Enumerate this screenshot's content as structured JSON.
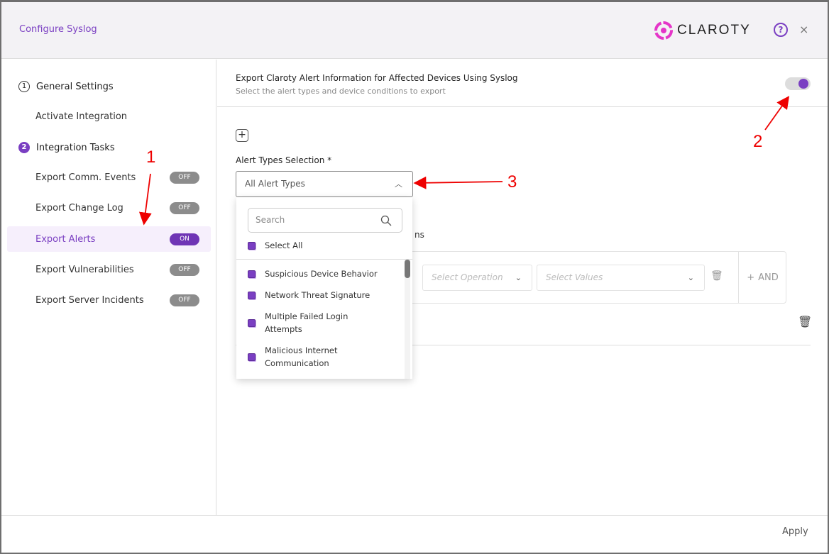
{
  "header": {
    "title": "Configure Syslog",
    "logo": "CLAROTY",
    "help_icon": "question-circle-icon",
    "close_label": "×"
  },
  "sidebar": {
    "sections": [
      {
        "num": "1",
        "label": "General Settings"
      },
      {
        "num": "2",
        "label": "Integration Tasks"
      }
    ],
    "items": [
      {
        "label": "Activate Integration"
      },
      {
        "label": "Export Comm. Events",
        "toggle": "OFF"
      },
      {
        "label": "Export Change Log",
        "toggle": "OFF"
      },
      {
        "label": "Export Alerts",
        "toggle": "ON",
        "active": true
      },
      {
        "label": "Export Vulnerabilities",
        "toggle": "OFF"
      },
      {
        "label": "Export Server Incidents",
        "toggle": "OFF"
      }
    ]
  },
  "main": {
    "title": "Export Claroty Alert Information for Affected Devices Using Syslog",
    "subtitle": "Select the alert types and device conditions to export",
    "enabled": true,
    "add_label": "+",
    "alert_types_label": "Alert Types Selection *",
    "alert_types_value": "All Alert Types",
    "partial_label": "ns",
    "condition": {
      "operation_placeholder": "Select Operation",
      "values_placeholder": "Select Values",
      "and_label": "AND"
    }
  },
  "dropdown": {
    "search_placeholder": "Search",
    "select_all": "Select All",
    "options": [
      "Suspicious Device Behavior",
      "Network Threat Signature",
      "Multiple Failed Login Attempts",
      "Malicious Internet Communication"
    ]
  },
  "footer": {
    "apply": "Apply"
  },
  "annotations": {
    "a1": "1",
    "a2": "2",
    "a3": "3",
    "color": "#e00000"
  },
  "colors": {
    "accent": "#7a3fc2",
    "logo": "#e535c8"
  }
}
